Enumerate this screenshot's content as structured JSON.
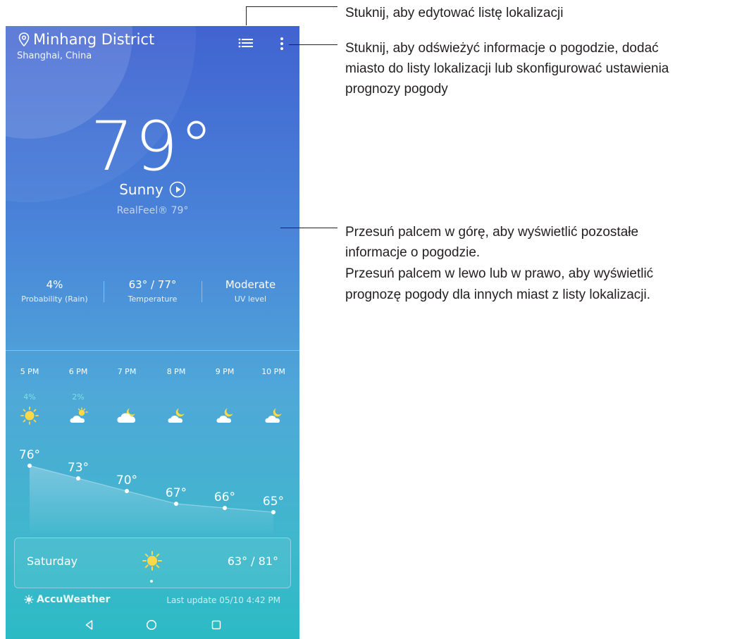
{
  "location": {
    "name": "Minhang District",
    "subtitle": "Shanghai, China",
    "pin_icon": "location-pin-icon"
  },
  "toolbar": {
    "list_icon": "list-icon",
    "more_icon": "more-vert-icon"
  },
  "current": {
    "temperature": "79°",
    "condition": "Sunny",
    "realfeel": "RealFeel® 79°"
  },
  "stats": [
    {
      "value": "4%",
      "label": "Probability (Rain)"
    },
    {
      "value": "63° / 77°",
      "label": "Temperature"
    },
    {
      "value": "Moderate",
      "label": "UV level"
    }
  ],
  "hourly": [
    {
      "time": "5 PM",
      "precip": "4%",
      "icon": "sunny-icon",
      "temp": "76°"
    },
    {
      "time": "6 PM",
      "precip": "2%",
      "icon": "partly-cloudy-day-icon",
      "temp": "73°"
    },
    {
      "time": "7 PM",
      "precip": "",
      "icon": "cloudy-night-icon",
      "temp": "70°"
    },
    {
      "time": "8 PM",
      "precip": "",
      "icon": "partly-cloudy-night-icon",
      "temp": "67°"
    },
    {
      "time": "9 PM",
      "precip": "",
      "icon": "partly-cloudy-night-icon",
      "temp": "66°"
    },
    {
      "time": "10 PM",
      "precip": "",
      "icon": "partly-cloudy-night-icon",
      "temp": "65°"
    }
  ],
  "daily": {
    "day": "Saturday",
    "icon": "sunny-icon",
    "range": "63° / 81°"
  },
  "footer": {
    "brand": "AccuWeather",
    "last_update": "Last update 05/10 4:42 PM"
  },
  "nav": {
    "back": "back-icon",
    "home": "home-icon",
    "recents": "recents-icon"
  },
  "annotations": {
    "list": "Stuknij, aby edytować listę lokalizacji",
    "menu_line1": "Stuknij, aby odświeżyć informacje o pogodzie, dodać",
    "menu_line2": "miasto do listy lokalizacji lub skonfigurować ustawienia",
    "menu_line3": "prognozy pogody",
    "swipe_line1": "Przesuń palcem w górę, aby wyświetlić pozostałe",
    "swipe_line2": "informacje o pogodzie.",
    "swipe_line3": "Przesuń palcem w lewo lub w prawo, aby wyświetlić",
    "swipe_line4": "prognozę pogody dla innych miast z listy lokalizacji."
  },
  "colors": {
    "top": "#4163d1",
    "bottom": "#2bbac5",
    "precip": "#7de2e0",
    "sun": "#ffd84a"
  }
}
